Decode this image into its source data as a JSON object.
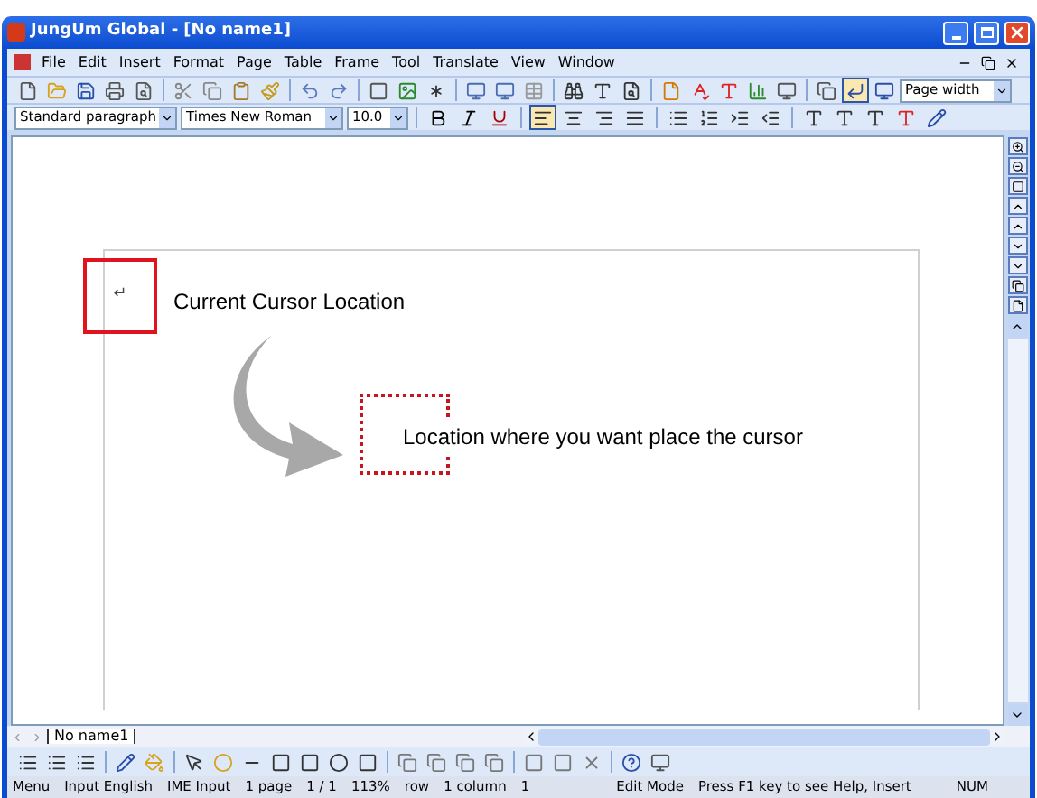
{
  "window": {
    "title": "JungUm Global - [No name1]"
  },
  "menu": [
    "File",
    "Edit",
    "Insert",
    "Format",
    "Page",
    "Table",
    "Frame",
    "Tool",
    "Translate",
    "View",
    "Window"
  ],
  "toolbar": {
    "zoom": "Page width",
    "style": "Standard paragraph",
    "font": "Times New Roman",
    "size": "10.0"
  },
  "document": {
    "cursor_mark": "↵",
    "current_label": "Current Cursor Location",
    "target_label": "Location where you want place the cursor"
  },
  "sheet_tab": "No name1",
  "status_bar": [
    "Menu",
    "Input English",
    "IME Input",
    "1 page",
    "1 / 1",
    "113%",
    "row",
    "1 column",
    "1",
    "Edit Mode",
    "Press F1 key to see Help, Insert",
    "NUM"
  ]
}
